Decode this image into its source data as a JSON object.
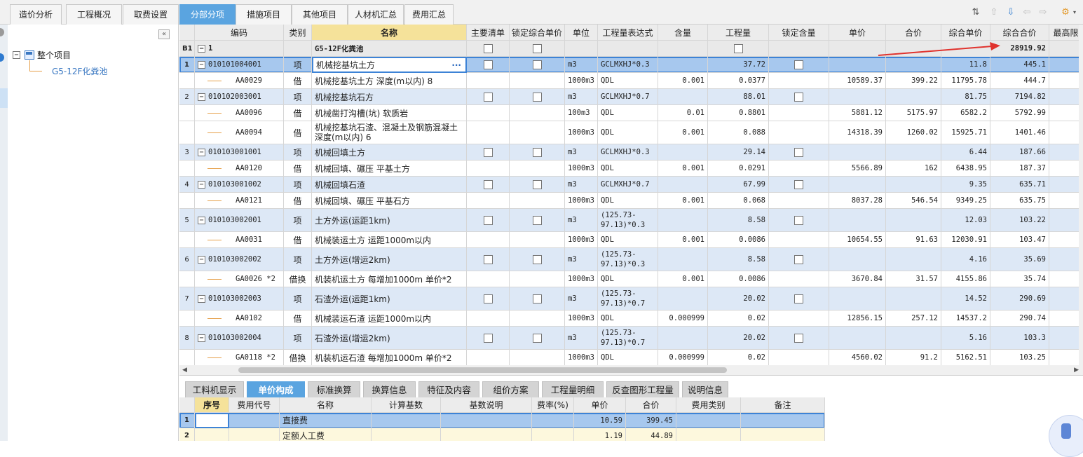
{
  "top_tabs": [
    "造价分析",
    "工程概况",
    "取费设置",
    "分部分项",
    "措施项目",
    "其他项目",
    "人材机汇总",
    "费用汇总"
  ],
  "top_active": 3,
  "tree": {
    "root": "整个项目",
    "child": "G5-12F化粪池",
    "collapse": "«"
  },
  "grid": {
    "headers": [
      "编码",
      "类别",
      "名称",
      "主要清单",
      "锁定综合单价",
      "单位",
      "工程量表达式",
      "含量",
      "工程量",
      "锁定含量",
      "单价",
      "合价",
      "综合单价",
      "综合合价",
      "最高限"
    ],
    "section": {
      "no": "B1",
      "code": "1",
      "name": "G5-12F化粪池",
      "total": "28919.92"
    },
    "rows": [
      {
        "no": "1",
        "code": "010101004001",
        "type": "项",
        "name": "机械挖基坑土方",
        "unit": "m3",
        "expr": "GCLMXHJ*0.3",
        "qty": "37.72",
        "sup": "11.8",
        "stot": "445.1",
        "item": true,
        "sel": true
      },
      {
        "code": "AA0029",
        "type": "借",
        "name": "机械挖基坑土方 深度(m以内) 8",
        "unit": "1000m3",
        "expr": "QDL",
        "content": "0.001",
        "qty": "0.0377",
        "price": "10589.37",
        "total": "399.22",
        "sup": "11795.78",
        "stot": "444.7"
      },
      {
        "no": "2",
        "code": "010102003001",
        "type": "项",
        "name": "机械挖基坑石方",
        "unit": "m3",
        "expr": "GCLMXHJ*0.7",
        "qty": "88.01",
        "sup": "81.75",
        "stot": "7194.82",
        "item": true
      },
      {
        "code": "AA0096",
        "type": "借",
        "name": "机械凿打沟槽(坑) 软质岩",
        "unit": "100m3",
        "expr": "QDL",
        "content": "0.01",
        "qty": "0.8801",
        "price": "5881.12",
        "total": "5175.97",
        "sup": "6582.2",
        "stot": "5792.99"
      },
      {
        "code": "AA0094",
        "type": "借",
        "name": "机械挖基坑石渣、混凝土及钢筋混凝土深度(m以内) 6",
        "unit": "1000m3",
        "expr": "QDL",
        "content": "0.001",
        "qty": "0.088",
        "price": "14318.39",
        "total": "1260.02",
        "sup": "15925.71",
        "stot": "1401.46",
        "h": 2
      },
      {
        "no": "3",
        "code": "010103001001",
        "type": "项",
        "name": "机械回填土方",
        "unit": "m3",
        "expr": "GCLMXHJ*0.3",
        "qty": "29.14",
        "sup": "6.44",
        "stot": "187.66",
        "item": true
      },
      {
        "code": "AA0120",
        "type": "借",
        "name": "机械回填、碾压 平基土方",
        "unit": "1000m3",
        "expr": "QDL",
        "content": "0.001",
        "qty": "0.0291",
        "price": "5566.89",
        "total": "162",
        "sup": "6438.95",
        "stot": "187.37"
      },
      {
        "no": "4",
        "code": "010103001002",
        "type": "项",
        "name": "机械回填石渣",
        "unit": "m3",
        "expr": "GCLMXHJ*0.7",
        "qty": "67.99",
        "sup": "9.35",
        "stot": "635.71",
        "item": true
      },
      {
        "code": "AA0121",
        "type": "借",
        "name": "机械回填、碾压 平基石方",
        "unit": "1000m3",
        "expr": "QDL",
        "content": "0.001",
        "qty": "0.068",
        "price": "8037.28",
        "total": "546.54",
        "sup": "9349.25",
        "stot": "635.75"
      },
      {
        "no": "5",
        "code": "010103002001",
        "type": "项",
        "name": "土方外运(运距1km)",
        "unit": "m3",
        "expr": "(125.73-97.13)*0.3",
        "qty": "8.58",
        "sup": "12.03",
        "stot": "103.22",
        "item": true,
        "h": 2
      },
      {
        "code": "AA0031",
        "type": "借",
        "name": "机械装运土方 运距1000m以内",
        "unit": "1000m3",
        "expr": "QDL",
        "content": "0.001",
        "qty": "0.0086",
        "price": "10654.55",
        "total": "91.63",
        "sup": "12030.91",
        "stot": "103.47"
      },
      {
        "no": "6",
        "code": "010103002002",
        "type": "项",
        "name": "土方外运(增运2km)",
        "unit": "m3",
        "expr": "(125.73-97.13)*0.3",
        "qty": "8.58",
        "sup": "4.16",
        "stot": "35.69",
        "item": true,
        "h": 2
      },
      {
        "code": "GA0026 *2",
        "type": "借换",
        "name": "机装机运土方 每增加1000m  单价*2",
        "unit": "1000m3",
        "expr": "QDL",
        "content": "0.001",
        "qty": "0.0086",
        "price": "3670.84",
        "total": "31.57",
        "sup": "4155.86",
        "stot": "35.74"
      },
      {
        "no": "7",
        "code": "010103002003",
        "type": "项",
        "name": "石渣外运(运距1km)",
        "unit": "m3",
        "expr": "(125.73-97.13)*0.7",
        "qty": "20.02",
        "sup": "14.52",
        "stot": "290.69",
        "item": true,
        "h": 2
      },
      {
        "code": "AA0102",
        "type": "借",
        "name": "机械装运石渣 运距1000m以内",
        "unit": "1000m3",
        "expr": "QDL",
        "content": "0.000999",
        "qty": "0.02",
        "price": "12856.15",
        "total": "257.12",
        "sup": "14537.2",
        "stot": "290.74"
      },
      {
        "no": "8",
        "code": "010103002004",
        "type": "项",
        "name": "石渣外运(增运2km)",
        "unit": "m3",
        "expr": "(125.73-97.13)*0.7",
        "qty": "20.02",
        "sup": "5.16",
        "stot": "103.3",
        "item": true,
        "h": 2
      },
      {
        "code": "GA0118 *2",
        "type": "借换",
        "name": "机装机运石渣 每增加1000m  单价*2",
        "unit": "1000m3",
        "expr": "QDL",
        "content": "0.000999",
        "qty": "0.02",
        "price": "4560.02",
        "total": "91.2",
        "sup": "5162.51",
        "stot": "103.25"
      }
    ]
  },
  "bottom_tabs": [
    "工料机显示",
    "单价构成",
    "标准换算",
    "换算信息",
    "特征及内容",
    "组价方案",
    "工程量明细",
    "反查图形工程量",
    "说明信息"
  ],
  "bottom_active": 1,
  "bgrid": {
    "headers": [
      "序号",
      "费用代号",
      "名称",
      "计算基数",
      "基数说明",
      "费率(%)",
      "单价",
      "合价",
      "费用类别",
      "备注"
    ],
    "rows": [
      {
        "no": "1",
        "name": "直接费",
        "price": "10.59",
        "total": "399.45",
        "sel": true
      },
      {
        "no": "2",
        "name": "定额人工费",
        "price": "1.19",
        "total": "44.89"
      }
    ]
  },
  "colors": {
    "accent": "#5aa4e0",
    "item_row": "#dde8f6",
    "selected_row": "#a7c8ee",
    "arrow": "#e0332e"
  }
}
